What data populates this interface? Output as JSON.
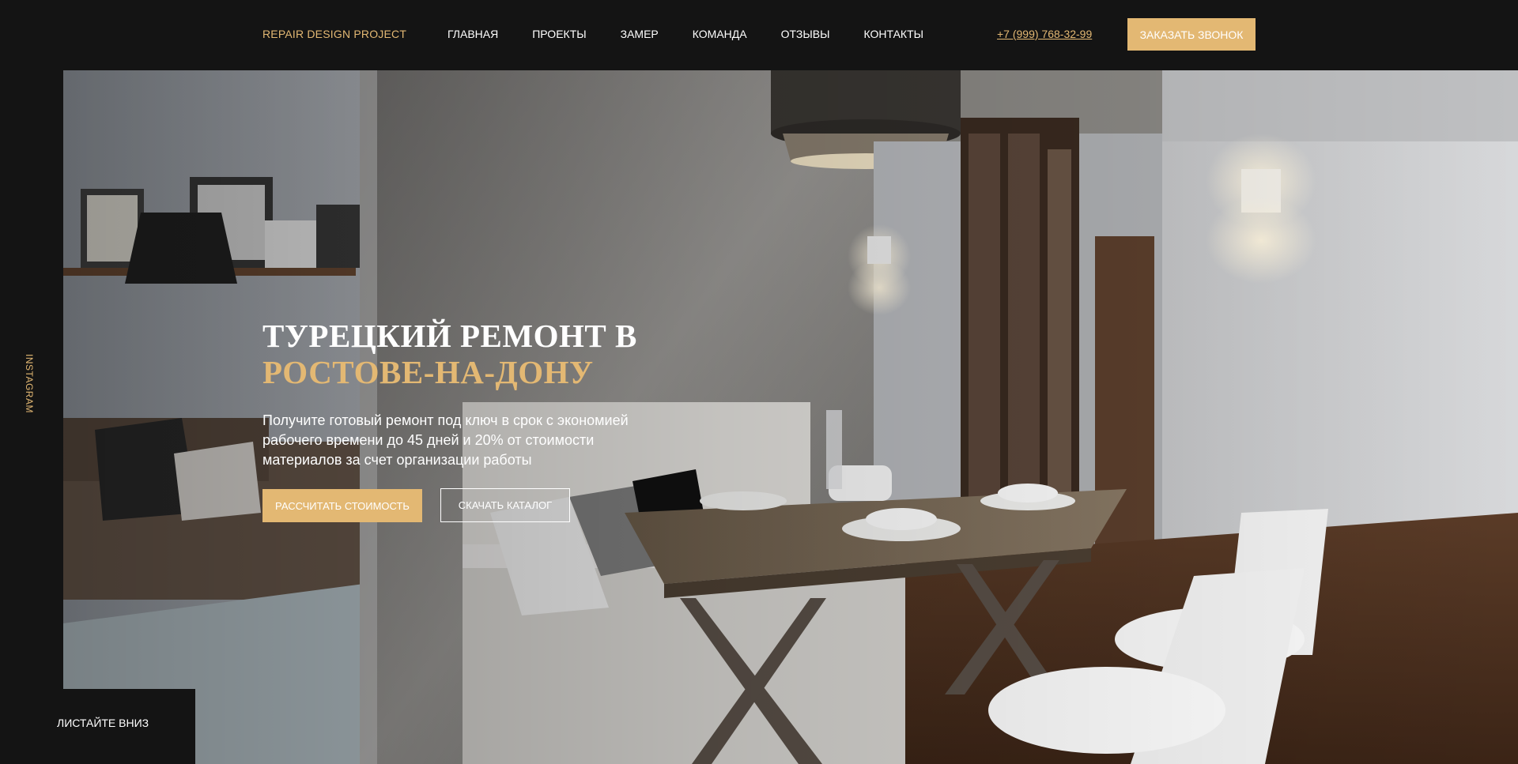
{
  "header": {
    "logo": "REPAIR DESIGN PROJECT",
    "nav": [
      "ГЛАВНАЯ",
      "ПРОЕКТЫ",
      "ЗАМЕР",
      "КОМАНДА",
      "ОТЗЫВЫ",
      "КОНТАКТЫ"
    ],
    "phone": "+7 (999) 768-32-99",
    "call_button": "ЗАКАЗАТЬ ЗВОНОК"
  },
  "sidebar": {
    "instagram": "INSTAGRAM",
    "scroll_down": "ЛИСТАЙТЕ ВНИЗ"
  },
  "hero": {
    "title_line1": "ТУРЕЦКИЙ РЕМОНТ В",
    "title_line2": "РОСТОВЕ-НА-ДОНУ",
    "subtitle": "Получите готовый ремонт под ключ в срок с экономией рабочего времени до 45 дней и 20% от стоимости материалов за счет организации работы",
    "calc_button": "РАССЧИТАТЬ СТОИМОСТЬ",
    "download_button": "СКАЧАТЬ КАТАЛОГ",
    "image_subject": "dining-room-interior"
  },
  "colors": {
    "background": "#141414",
    "accent": "#e3b873",
    "text": "#ffffff"
  }
}
